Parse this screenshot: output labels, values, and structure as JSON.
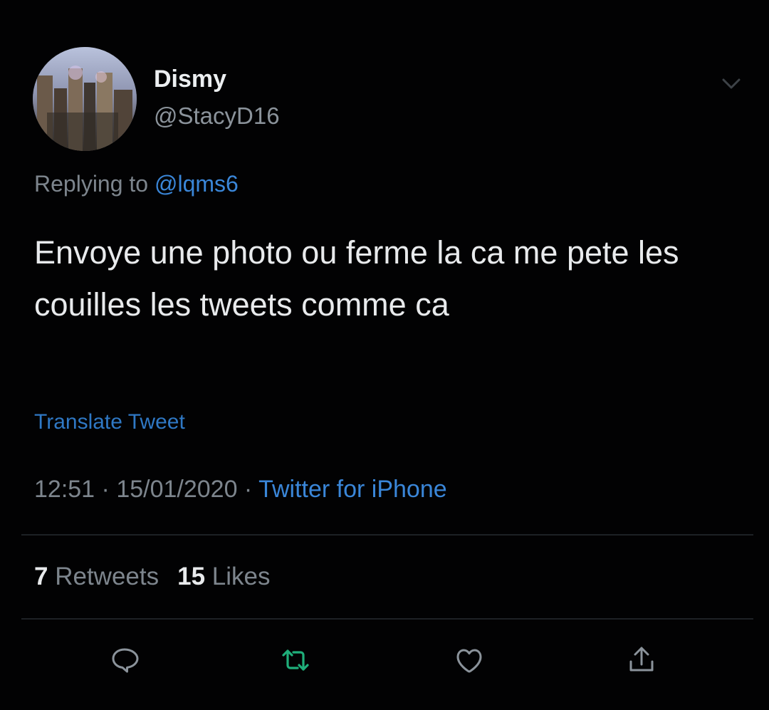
{
  "author": {
    "display_name": "Dismy",
    "handle": "@StacyD16"
  },
  "reply": {
    "prefix": "Replying to ",
    "mention": "@lqms6"
  },
  "tweet": {
    "text": "Envoye une photo ou ferme la ca me pete les couilles les tweets comme ca",
    "translate_label": "Translate Tweet"
  },
  "meta": {
    "time": "12:51",
    "separator": " · ",
    "date": "15/01/2020",
    "source": "Twitter for iPhone"
  },
  "stats": {
    "retweets_count": "7",
    "retweets_label": "Retweets",
    "likes_count": "15",
    "likes_label": "Likes"
  },
  "colors": {
    "background": "#020203",
    "link": "#3a86d8",
    "secondary_text": "#7d858d",
    "retweet_active": "#1fae7a"
  },
  "icons": {
    "menu": "chevron-down-icon",
    "reply": "reply-icon",
    "retweet": "retweet-icon",
    "like": "heart-icon",
    "share": "share-icon"
  }
}
